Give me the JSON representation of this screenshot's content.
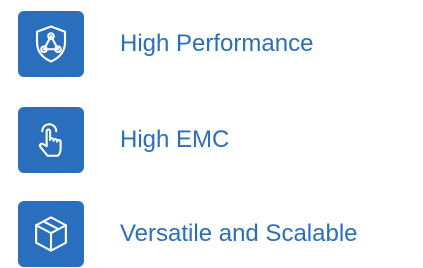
{
  "colors": {
    "accent": "#2a6fbe",
    "icon_stroke": "#ffffff"
  },
  "features": [
    {
      "label": "High Performance",
      "icon": "shield-network-icon"
    },
    {
      "label": "High EMC",
      "icon": "tap-hand-icon"
    },
    {
      "label": "Versatile and Scalable",
      "icon": "cube-icon"
    }
  ]
}
